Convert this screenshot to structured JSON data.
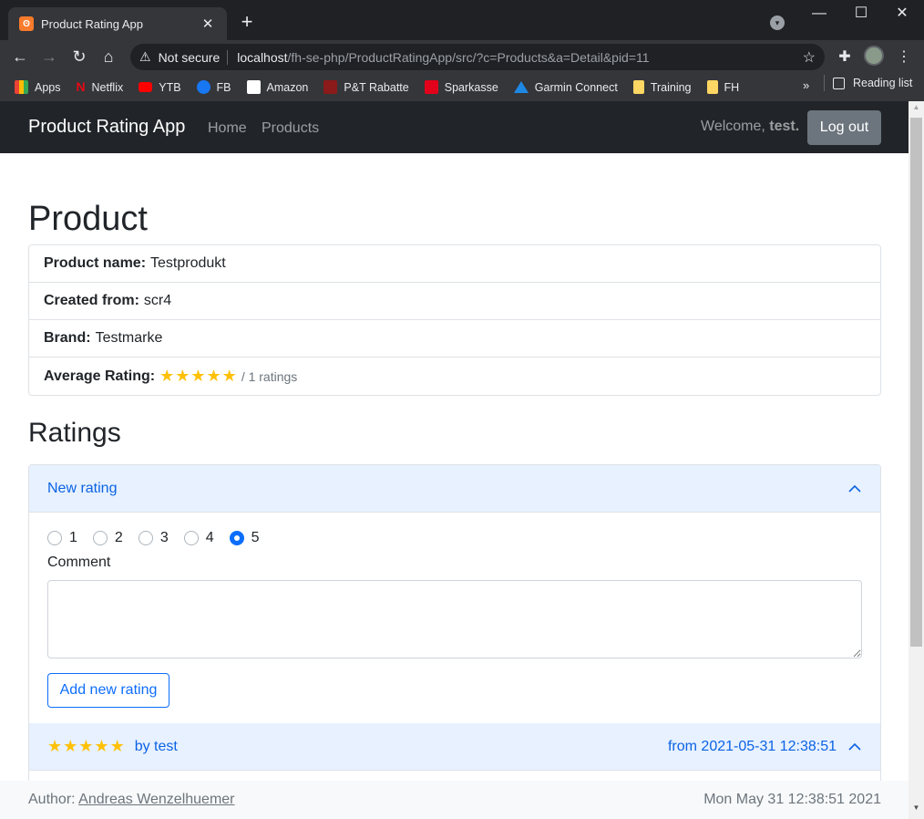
{
  "browser": {
    "tab_title": "Product Rating App",
    "tab_favicon": "xampp-icon",
    "new_tab": "+",
    "minimize": "—",
    "maximize": "☐",
    "close": "✕",
    "security_label": "Not secure",
    "url_host": "localhost",
    "url_path": "/fh-se-php/ProductRatingApp/src/?c=Products&a=Detail&pid=11",
    "bookmarks": [
      {
        "label": "Apps",
        "icon": "apps-grid-icon",
        "color": "#ea4335"
      },
      {
        "label": "Netflix",
        "icon": "netflix-icon",
        "color": "#e50914"
      },
      {
        "label": "YTB",
        "icon": "youtube-icon",
        "color": "#ff0000"
      },
      {
        "label": "FB",
        "icon": "facebook-icon",
        "color": "#1877f2"
      },
      {
        "label": "Amazon",
        "icon": "amazon-icon",
        "color": "#ffffff"
      },
      {
        "label": "P&T Rabatte",
        "icon": "pt-icon",
        "color": "#8b1a1a"
      },
      {
        "label": "Sparkasse",
        "icon": "sparkasse-icon",
        "color": "#e2001a"
      },
      {
        "label": "Garmin Connect",
        "icon": "garmin-icon",
        "color": "#1e88e5"
      },
      {
        "label": "Training",
        "icon": "folder-icon",
        "color": "#fdd663"
      },
      {
        "label": "FH",
        "icon": "folder-icon",
        "color": "#fdd663"
      }
    ],
    "more_bookmarks": "»",
    "reading_list": "Reading list"
  },
  "app": {
    "brand": "Product Rating App",
    "nav": {
      "home": "Home",
      "products": "Products"
    },
    "welcome_prefix": "Welcome,",
    "username": "test.",
    "logout": "Log out"
  },
  "product": {
    "heading": "Product",
    "name_label": "Product name:",
    "name_value": "Testprodukt",
    "created_label": "Created from:",
    "created_value": "scr4",
    "brand_label": "Brand:",
    "brand_value": "Testmarke",
    "avg_label": "Average Rating:",
    "avg_stars": 5,
    "ratings_count": "/ 1 ratings"
  },
  "ratings": {
    "heading": "Ratings",
    "new_rating_title": "New rating",
    "options": [
      "1",
      "2",
      "3",
      "4",
      "5"
    ],
    "selected": "5",
    "comment_label": "Comment",
    "comment_value": "",
    "add_button": "Add new rating",
    "items": [
      {
        "stars": 5,
        "by": "by test",
        "date": "from 2021-05-31 12:38:51"
      }
    ]
  },
  "footer": {
    "author_prefix": "Author:",
    "author_name": "Andreas Wenzelhuemer",
    "datetime": "Mon May 31 12:38:51 2021"
  },
  "colors": {
    "navbar": "#212529",
    "accent": "#0d6efd",
    "star": "#ffc107",
    "accordion_header": "#e7f1ff"
  }
}
